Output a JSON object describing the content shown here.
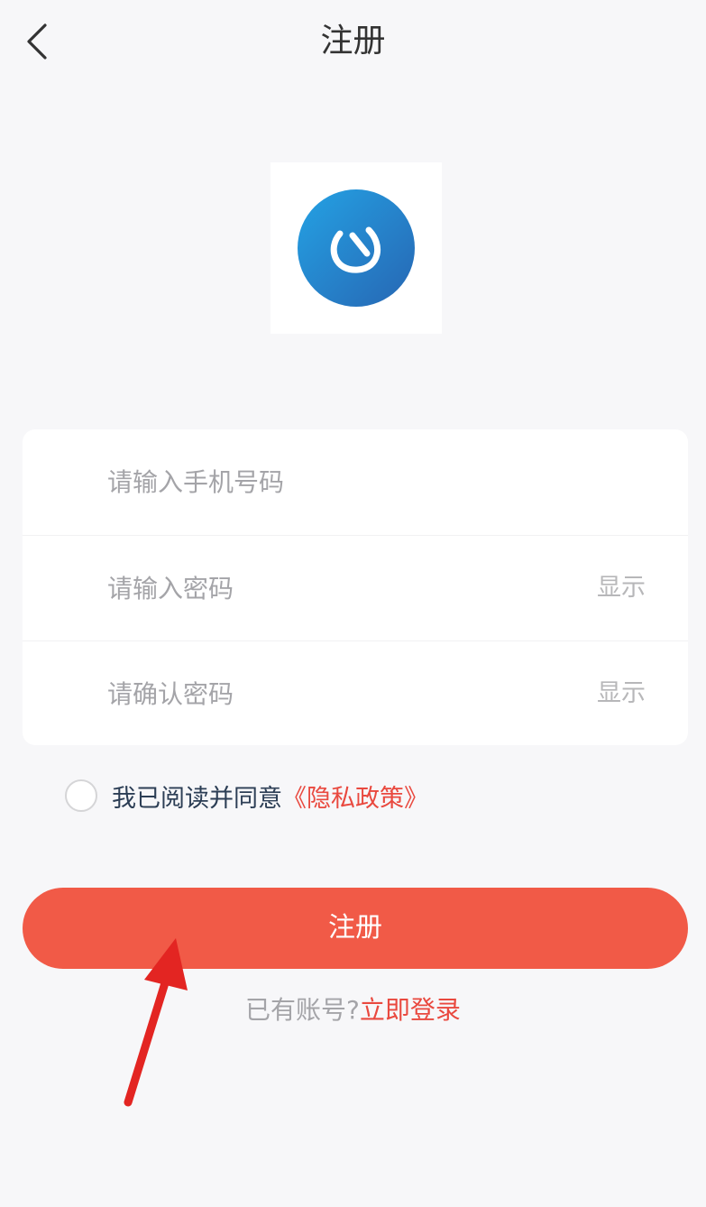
{
  "header": {
    "title": "注册",
    "back_icon": "chevron-left-icon"
  },
  "logo": {
    "icon": "app-logo",
    "accent_color": "#2a8fd8"
  },
  "form": {
    "phone_placeholder": "请输入手机号码",
    "password_placeholder": "请输入密码",
    "password_toggle": "显示",
    "confirm_placeholder": "请确认密码",
    "confirm_toggle": "显示"
  },
  "agreement": {
    "text": "我已阅读并同意",
    "link": "《隐私政策》"
  },
  "register_button": {
    "label": "注册",
    "color": "#f15a47"
  },
  "login_prompt": {
    "question": "已有账号?",
    "link": "立即登录"
  },
  "annotation": {
    "icon": "red-arrow-icon",
    "color": "#e32522"
  }
}
